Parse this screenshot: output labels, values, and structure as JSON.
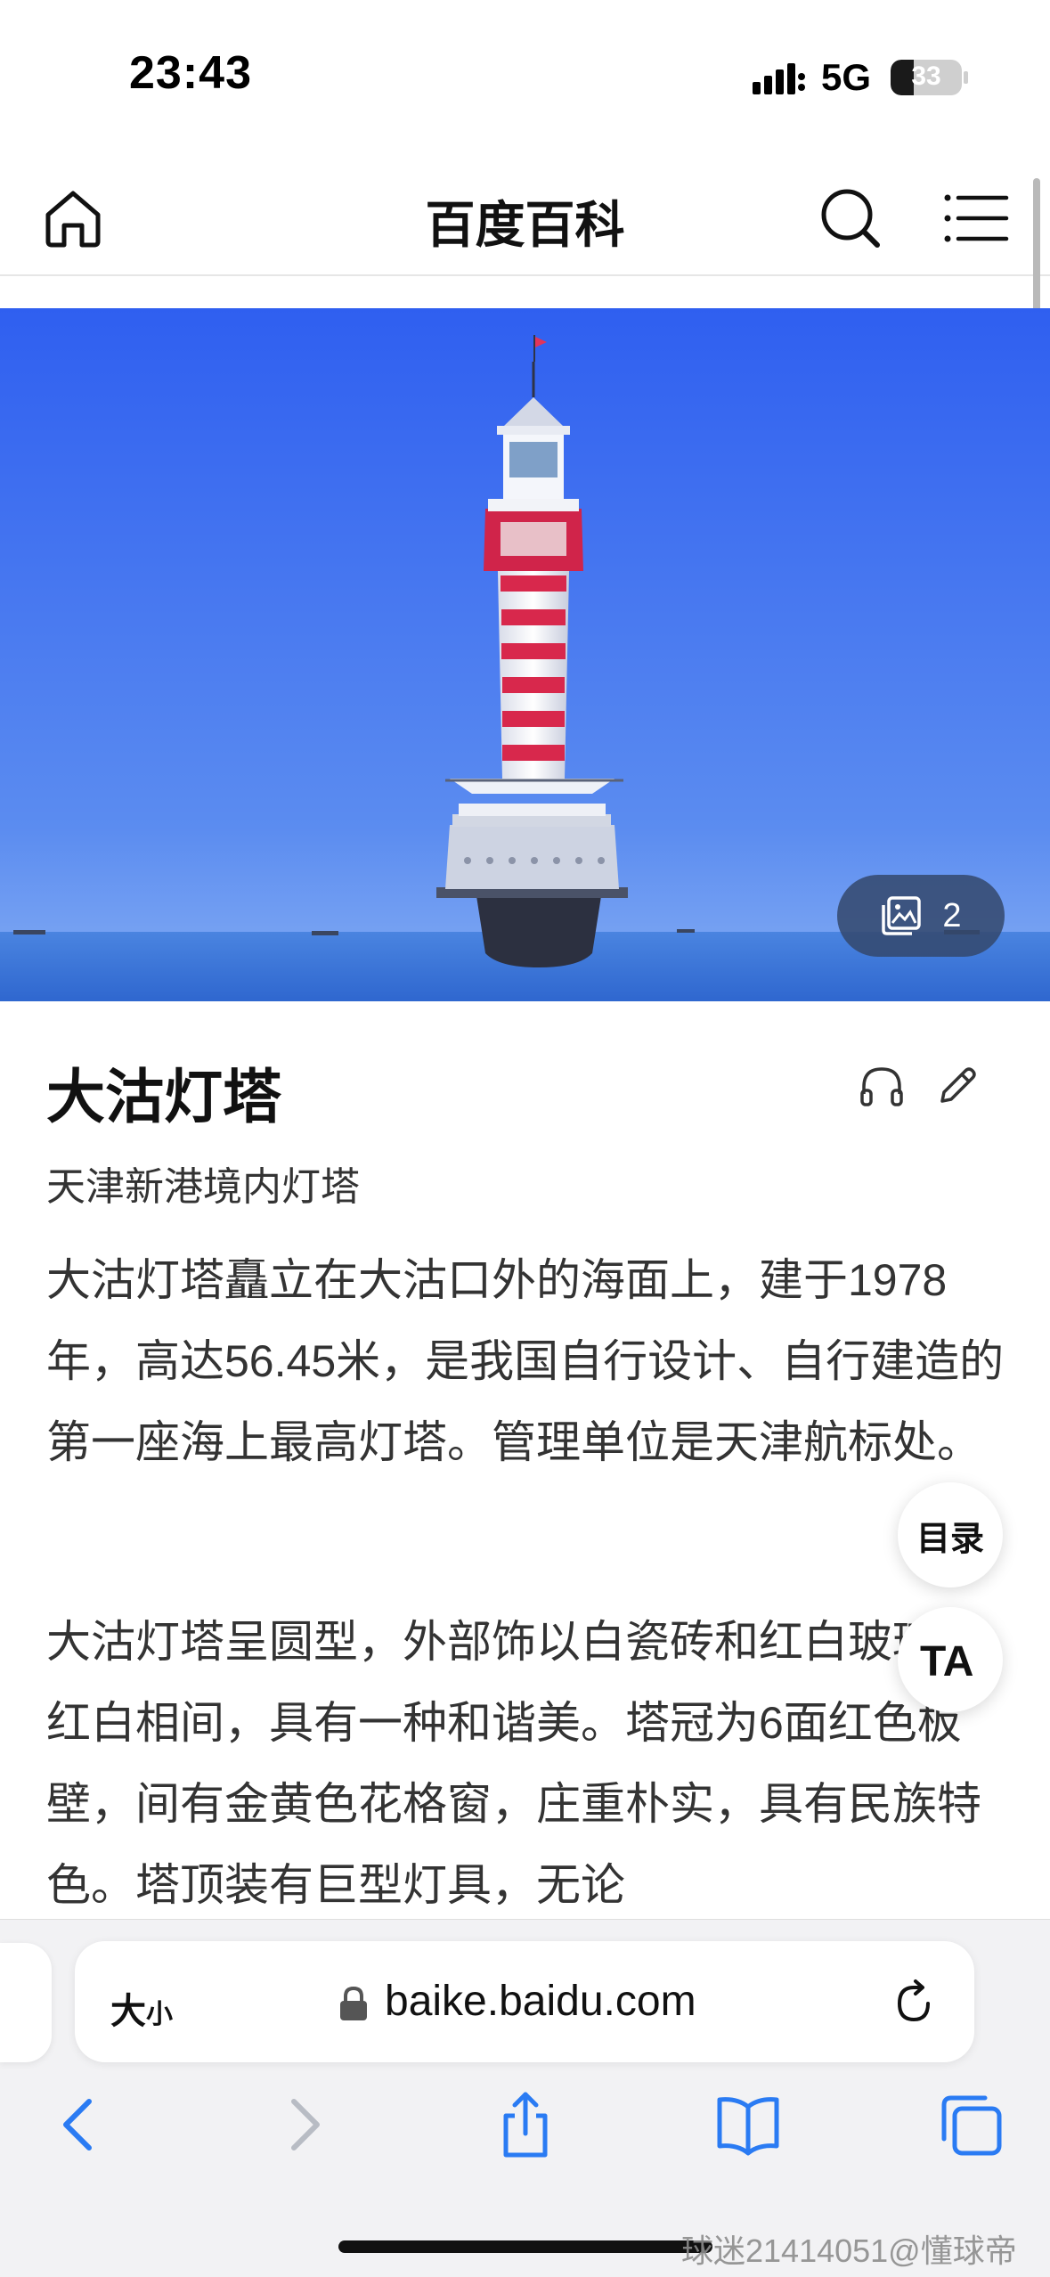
{
  "status_bar": {
    "time": "23:43",
    "network": "5G",
    "battery": "33",
    "battery_level": 0.33
  },
  "header": {
    "title": "百度百科",
    "home_icon": "home-icon",
    "search_icon": "search-icon",
    "menu_icon": "menu-icon"
  },
  "hero": {
    "gallery_count": "2",
    "gallery_icon": "gallery-icon"
  },
  "article": {
    "title": "大沽灯塔",
    "subtitle": "天津新港境内灯塔",
    "paragraph1": "大沽灯塔矗立在大沽口外的海面上，建于1978年，高达56.45米，是我国自行设计、自行建造的第一座海上最高灯塔。管理单位是天津航标处。",
    "paragraph2": "大沽灯塔呈圆型，外部饰以白瓷砖和红白玻璃，红白相间，具有一种和谐美。塔冠为6面红色板壁，间有金黄色花格窗，庄重朴实，具有民族特色。塔顶装有巨型灯具，无论"
  },
  "floating": {
    "toc_label": "目录",
    "font_label": "TA"
  },
  "browser": {
    "text_size_label_big": "大",
    "text_size_label_small": "小",
    "url": "baike.baidu.com"
  },
  "watermark": "球迷21414051@懂球帝",
  "colors": {
    "sky_top": "#2f5ff0",
    "sky_bottom": "#6c9cf2",
    "sea": "#3c78dc",
    "stripe_red": "#d8284c",
    "safari_blue": "#2a7bf3"
  }
}
